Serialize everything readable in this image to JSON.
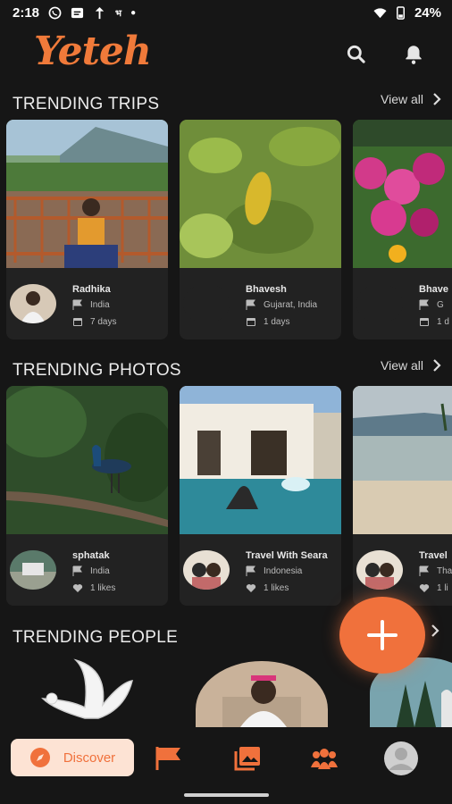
{
  "status_bar": {
    "time": "2:18",
    "battery": "24%"
  },
  "app": {
    "logo": "Yeteh"
  },
  "sections": {
    "trips": {
      "title": "TRENDING TRIPS",
      "view_all": "View all",
      "cards": [
        {
          "name": "Radhika",
          "location": "India",
          "duration": "7 days"
        },
        {
          "name": "Bhavesh",
          "location": "Gujarat, India",
          "duration": "1 days"
        },
        {
          "name": "Bhave",
          "location": "G",
          "duration": "1 d"
        }
      ]
    },
    "photos": {
      "title": "TRENDING PHOTOS",
      "view_all": "View all",
      "cards": [
        {
          "name": "sphatak",
          "location": "India",
          "likes": "1 likes"
        },
        {
          "name": "Travel With Seara",
          "location": "Indonesia",
          "likes": "1 likes"
        },
        {
          "name": "Travel",
          "location": "Tha",
          "likes": "1 li"
        }
      ]
    },
    "people": {
      "title": "TRENDING PEOPLE"
    }
  },
  "bottom_nav": {
    "discover": "Discover"
  },
  "colors": {
    "accent": "#f0713c",
    "background": "#161616",
    "card": "#222222",
    "discover_bg": "#fde3d4"
  }
}
